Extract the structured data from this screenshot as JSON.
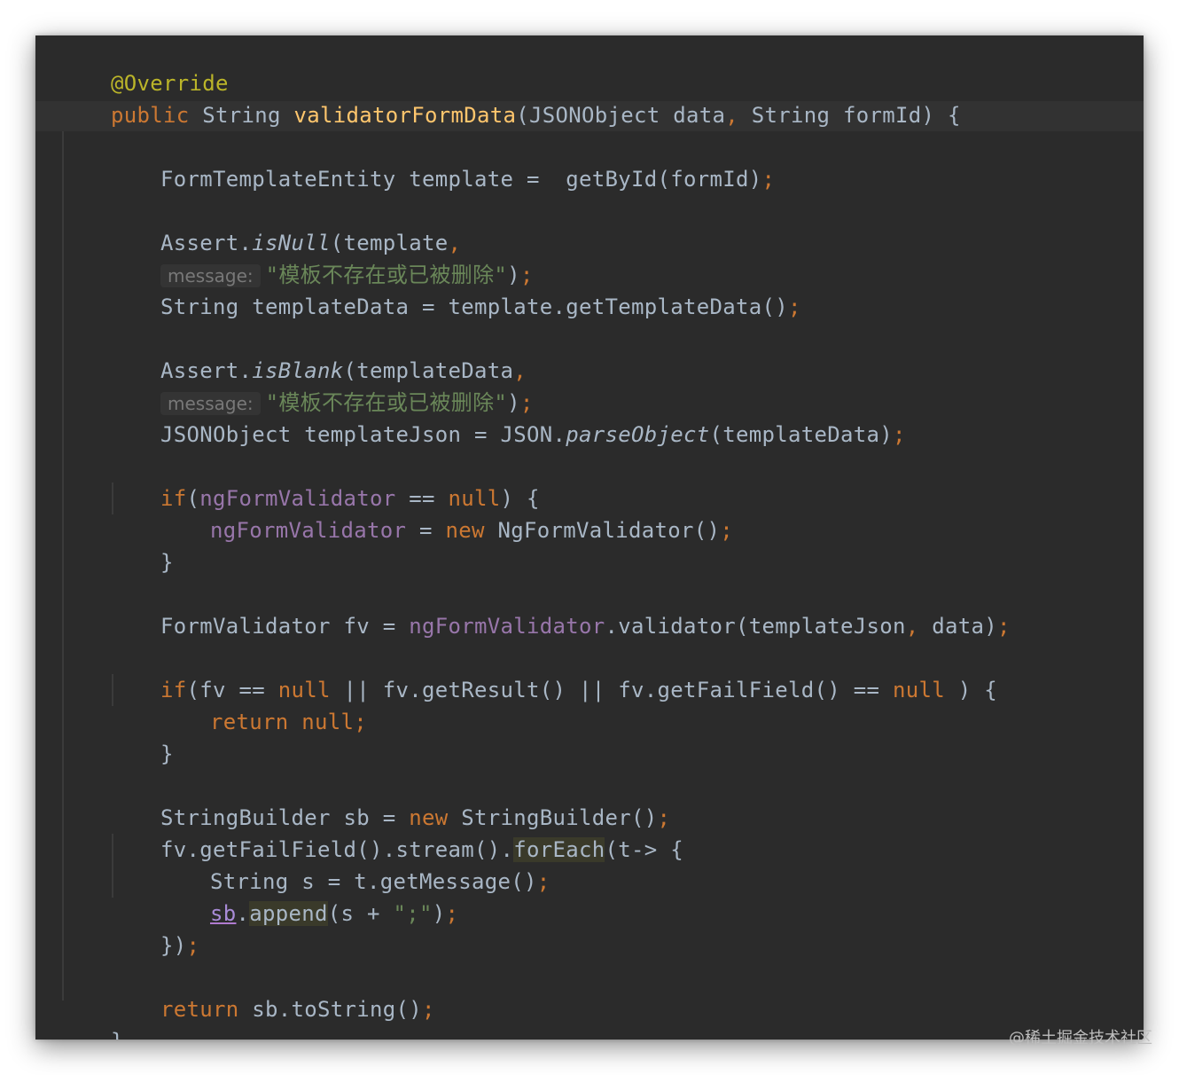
{
  "code": {
    "annotation": "@Override",
    "sig_public": "public",
    "sig_string": " String ",
    "sig_method": "validatorFormData",
    "sig_params": "(JSONObject data",
    "sig_comma": ",",
    "sig_params2": " String formId) {",
    "l1_a": "FormTemplateEntity template =  getById(formId)",
    "semi": ";",
    "l2_a": "Assert.",
    "l2_m": "isNull",
    "l2_b": "(template",
    "l2_c": ",",
    "hint_label": "message:",
    "l2_str": "\"模板不存在或已被删除\"",
    "l2_end": ")",
    "l3_a": "String templateData = template.getTemplateData()",
    "l4_a": "Assert.",
    "l4_m": "isBlank",
    "l4_b": "(templateData",
    "l4_c": ",",
    "l4_str": "\"模板不存在或已被删除\"",
    "l4_end": ")",
    "l5_a": "JSONObject templateJson = JSON.",
    "l5_m": "parseObject",
    "l5_b": "(templateData)",
    "if_kw": "if",
    "l6_a": "(",
    "l6_fld": "ngFormValidator",
    "l6_b": " == ",
    "null_kw": "null",
    "l6_c": ") {",
    "l7_fld": "ngFormValidator",
    "l7_a": " = ",
    "new_kw": "new",
    "l7_b": " NgFormValidator()",
    "close_brace": "}",
    "l9_a": "FormValidator fv = ",
    "l9_fld": "ngFormValidator",
    "l9_b": ".validator(templateJson",
    "l9_c": ",",
    "l9_d": " data)",
    "l10_a": "(fv == ",
    "l10_b": " || fv.getResult() || fv.getFailField() == ",
    "l10_c": " ) {",
    "return_kw": "return",
    "l11_null": " null",
    "l13_a": "StringBuilder sb = ",
    "l13_b": " StringBuilder()",
    "l14_a": "fv.getFailField().stream().",
    "l14_m": "forEach",
    "l14_b": "(t-> {",
    "l15_a": "String s = t.getMessage()",
    "l16_sb": "sb",
    "l16_dot": ".",
    "l16_m": "append",
    "l16_b": "(s + ",
    "l16_str": "\";\"",
    "l16_end": ")",
    "l17_a": "})",
    "l18_b": " sb.toString()",
    "final_brace": "}"
  },
  "watermark": "@稀土掘金技术社区",
  "colors": {
    "background": "#2b2b2b",
    "keyword": "#cc7832",
    "annotation": "#bbb529",
    "method": "#ffc66d",
    "field": "#9876aa",
    "string": "#6a8759",
    "text": "#a9b7c6"
  }
}
